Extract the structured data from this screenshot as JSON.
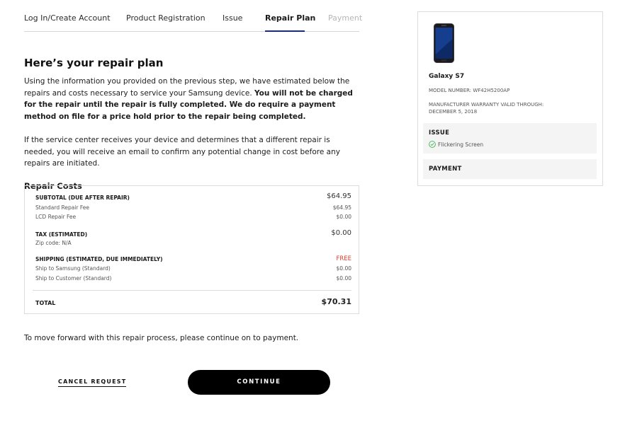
{
  "tabs": [
    {
      "label": "Log In/Create Account",
      "state": "default"
    },
    {
      "label": "Product Registration",
      "state": "default"
    },
    {
      "label": "Issue",
      "state": "default"
    },
    {
      "label": "Repair Plan",
      "state": "active"
    },
    {
      "label": "Payment",
      "state": "disabled"
    }
  ],
  "main": {
    "title": "Here’s your repair plan",
    "intro": "Using the information you provided on the previous step, we have estimated below the repairs and costs necessary to service your Samsung device.",
    "intro_bold": "You will not be charged for the repair until the repair is fully completed. We do require a payment method on file for a price hold prior to the repair being completed.",
    "notice": "If the service center receives your device and determines that a different repair is needed, you will receive an email to confirm any potential change in cost before any repairs are initiated.",
    "costs_title": "Repair Costs"
  },
  "costs": {
    "subtotal_label": "SUBTOTAL (DUE AFTER REPAIR)",
    "subtotal_value": "$64.95",
    "standard_fee_label": "Standard Repair Fee",
    "standard_fee_value": "$64.95",
    "lcd_fee_label": "LCD Repair Fee",
    "lcd_fee_value": "$0.00",
    "tax_label": "TAX (ESTIMATED)",
    "tax_value": "$0.00",
    "zip_label": "Zip code: N/A",
    "shipping_label": "SHIPPING (ESTIMATED, DUE IMMEDIATELY)",
    "shipping_value": "FREE",
    "ship_samsung_label": "Ship to Samsung (Standard)",
    "ship_samsung_value": "$0.00",
    "ship_customer_label": "Ship to Customer (Standard)",
    "ship_customer_value": "$0.00",
    "total_label": "TOTAL",
    "total_value": "$70.31"
  },
  "footer": {
    "text": "To move forward with this repair process, please continue on to payment.",
    "cancel_label": "CANCEL REQUEST",
    "continue_label": "CONTINUE"
  },
  "sidebar": {
    "device_name": "Galaxy S7",
    "model_number": "MODEL NUMBER: WF42H5200AP",
    "warranty_label": "MANUFACTURER WARRANTY VALID THROUGH:",
    "warranty_date": "DECEMBER 5, 2018",
    "issue_title": "ISSUE",
    "issue_item": "Flickering Screen",
    "payment_title": "PAYMENT",
    "device_icon": "phone-icon",
    "check_icon": "check-circle-icon"
  },
  "colors": {
    "accent": "#1428a0",
    "free": "#e03c31",
    "check": "#3fb34f"
  }
}
